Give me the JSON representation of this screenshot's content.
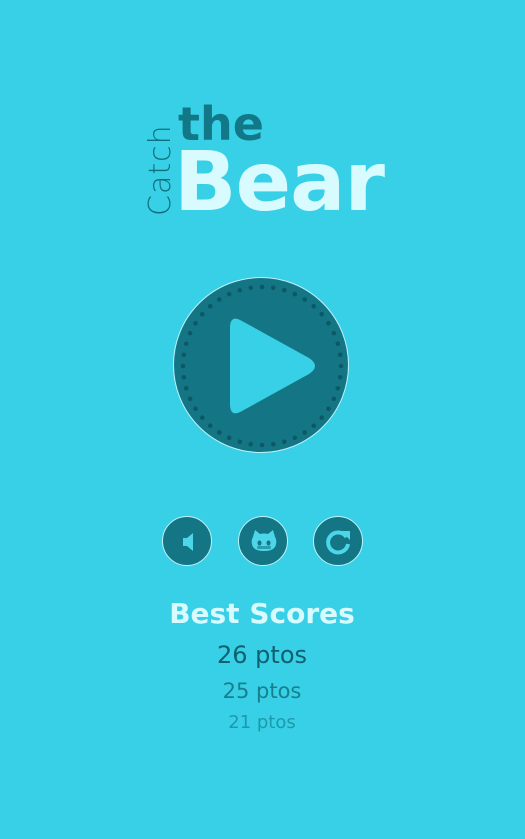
{
  "colors": {
    "background": "#38d0e6",
    "button_fill": "#147685",
    "button_border": "#bff2fa",
    "play_triangle": "#38d0e6",
    "dots": "#0d5865",
    "title_light": "#d8fbff",
    "title_dark": "#127786"
  },
  "logo": {
    "catch": "Catch",
    "the": "the",
    "bear": "Bear"
  },
  "controls": {
    "play_icon": "play-icon",
    "sound_icon": "volume-icon",
    "github_icon": "github-cat-icon",
    "restart_icon": "restart-icon"
  },
  "scores": {
    "title": "Best Scores",
    "items": [
      "26 ptos",
      "25 ptos",
      "21 ptos"
    ]
  }
}
